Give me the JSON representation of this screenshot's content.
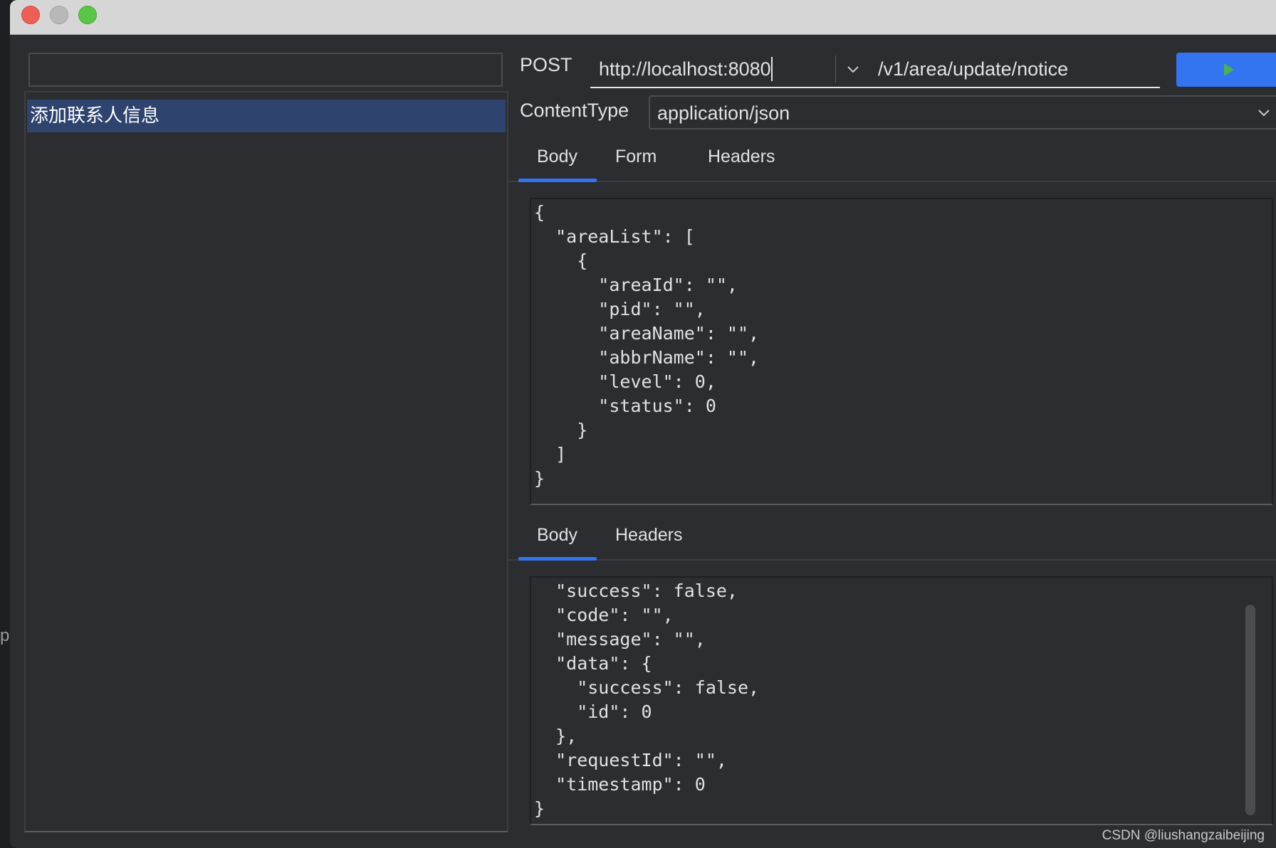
{
  "left_edge": {
    "glyph": "p"
  },
  "sidebar": {
    "search_value": "",
    "items": [
      {
        "label": "添加联系人信息",
        "selected": true
      }
    ]
  },
  "request": {
    "method": "POST",
    "host": "http://localhost:8080",
    "path": "/v1/area/update/notice",
    "content_type_label": "ContentType",
    "content_type_value": "application/json",
    "tabs": [
      {
        "label": "Body",
        "active": true
      },
      {
        "label": "Form",
        "active": false
      },
      {
        "label": "Headers",
        "active": false
      }
    ],
    "body": "{\n  \"areaList\": [\n    {\n      \"areaId\": \"\",\n      \"pid\": \"\",\n      \"areaName\": \"\",\n      \"abbrName\": \"\",\n      \"level\": 0,\n      \"status\": 0\n    }\n  ]\n}"
  },
  "response": {
    "tabs": [
      {
        "label": "Body",
        "active": true
      },
      {
        "label": "Headers",
        "active": false
      }
    ],
    "body": "  \"success\": false,\n  \"code\": \"\",\n  \"message\": \"\",\n  \"data\": {\n    \"success\": false,\n    \"id\": 0\n  },\n  \"requestId\": \"\",\n  \"timestamp\": 0\n}"
  },
  "colors": {
    "accent": "#3574f0",
    "selection": "#2e436e",
    "send_icon": "#4caf50",
    "panel_bg": "#2b2d30"
  },
  "icons": {
    "send": "play-icon",
    "dropdown": "chevron-down-icon"
  },
  "watermark": "CSDN @liushangzaibeijing"
}
